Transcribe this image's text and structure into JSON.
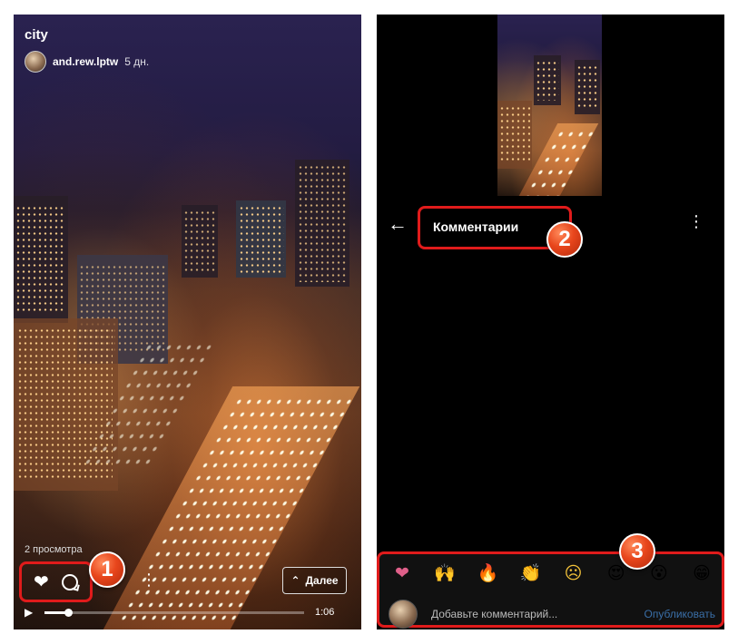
{
  "left_panel": {
    "video_title": "city",
    "author": {
      "name": "and.rew.lptw",
      "time": "5 дн."
    },
    "views": "2 просмотра",
    "next_label": "Далее",
    "duration": "1:06",
    "progress": 0.09
  },
  "right_panel": {
    "header_title": "Комментарии",
    "emojis": [
      "❤",
      "🙌",
      "🔥",
      "👏",
      "☹",
      "😍",
      "😮",
      "😁"
    ],
    "comment_placeholder": "Добавьте комментарий...",
    "publish_label": "Опубликовать"
  },
  "markers": {
    "m1": "1",
    "m2": "2",
    "m3": "3"
  },
  "colors": {
    "highlight": "#e01b1b",
    "marker": "#e8461c",
    "heart": "#e0608a",
    "publish": "#3a6fa8"
  }
}
